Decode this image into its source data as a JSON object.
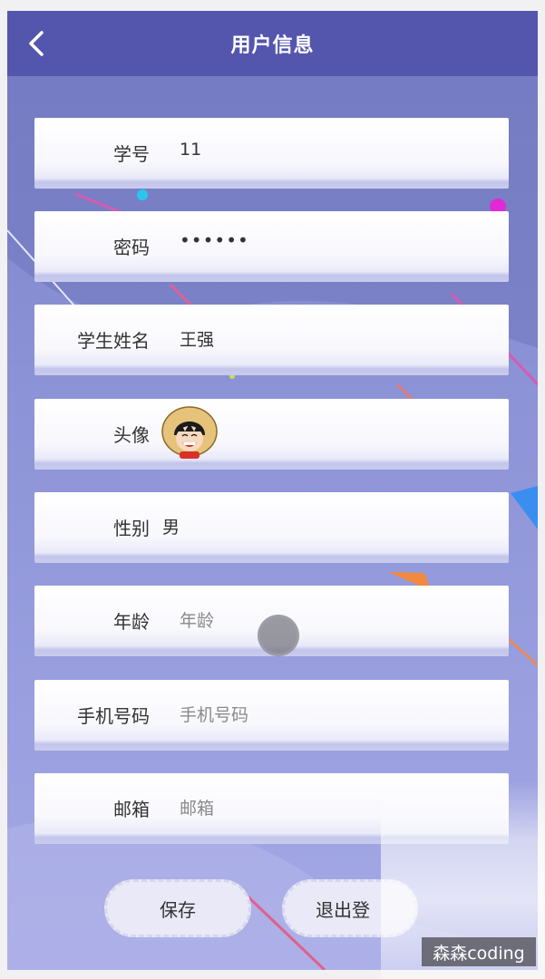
{
  "header": {
    "title": "用户信息",
    "back_icon": "chevron-left-icon"
  },
  "form": {
    "student_id": {
      "label": "学号",
      "value": "11"
    },
    "password": {
      "label": "密码",
      "value": "••••••"
    },
    "student_name": {
      "label": "学生姓名",
      "value": "王强"
    },
    "avatar": {
      "label": "头像",
      "icon": "avatar-image"
    },
    "gender": {
      "label": "性别",
      "value": "男"
    },
    "age": {
      "label": "年龄",
      "placeholder": "年龄"
    },
    "phone": {
      "label": "手机号码",
      "placeholder": "手机号码"
    },
    "email": {
      "label": "邮箱",
      "placeholder": "邮箱"
    }
  },
  "actions": {
    "save_label": "保存",
    "logout_label": "退出登"
  },
  "watermark": "森森coding",
  "colors": {
    "header": "#5456ad",
    "background": "#8c93d6",
    "card": "#ffffff",
    "button": "#e9e9f7"
  }
}
